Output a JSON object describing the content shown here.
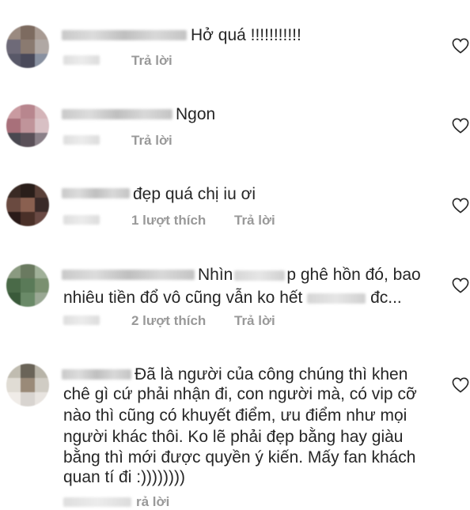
{
  "comments": [
    {
      "text": "Hở quá !!!!!!!!!!!",
      "reply_label": "Trả lời"
    },
    {
      "text": "Ngon",
      "reply_label": "Trả lời"
    },
    {
      "text": "đẹp quá chị iu ơi",
      "likes_label": "1 lượt thích",
      "reply_label": "Trả lời"
    },
    {
      "text_part1": "Nhìn",
      "text_part2": "p ghê hồn đó, bao",
      "text_line2a": "nhiêu tiền đổ vô cũng vẫn ko hết",
      "text_line2b": "đc...",
      "likes_label": "2 lượt thích",
      "reply_label": "Trả lời"
    },
    {
      "lines": [
        "Đã là người của công chúng thì khen",
        "chê gì cứ phải nhận đi, con người mà, có vip cỡ",
        "nào thì cũng có khuyết điểm, ưu điểm như mọi",
        "người khác thôi. Ko lẽ phải đẹp bằng hay giàu",
        "bằng thì mới được quyền ý kiến. Mấy fan khách",
        "quan tí đi :))))))))"
      ],
      "reply_label": "rả lời"
    }
  ],
  "icons": {
    "like": "heart-outline-icon"
  },
  "colors": {
    "text": "#262626",
    "meta": "#999999",
    "heart": "#262626"
  }
}
